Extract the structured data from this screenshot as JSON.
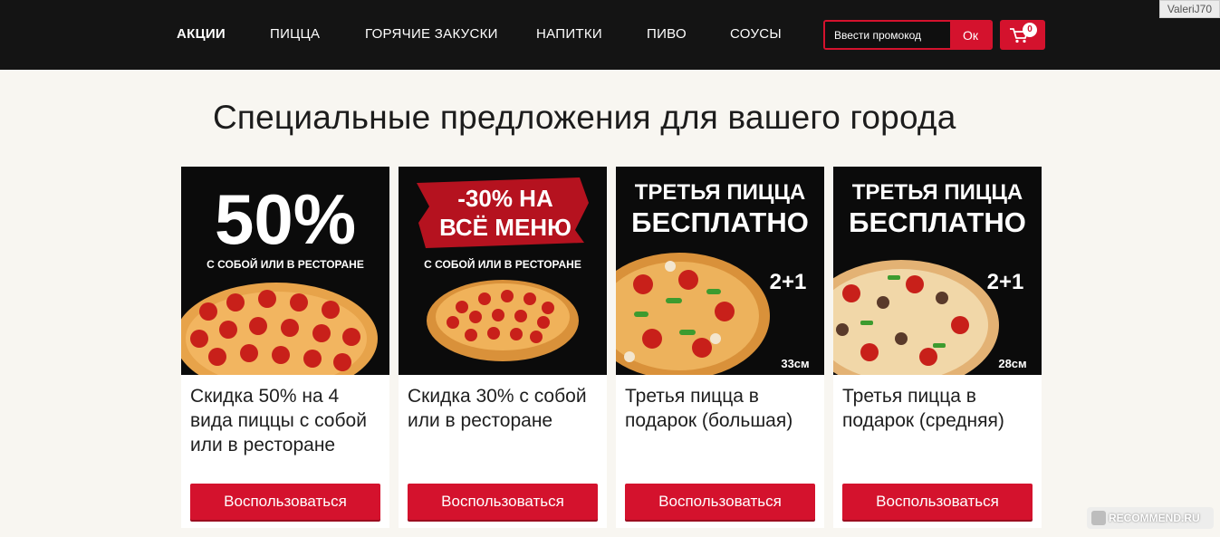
{
  "nav": {
    "items": [
      {
        "label": "АКЦИИ"
      },
      {
        "label": "ПИЦЦА"
      },
      {
        "label": "ГОРЯЧИЕ ЗАКУСКИ"
      },
      {
        "label": "НАПИТКИ"
      },
      {
        "label": "ПИВО"
      },
      {
        "label": "СОУСЫ"
      }
    ]
  },
  "promo": {
    "placeholder": "Ввести промокод",
    "button": "Ок"
  },
  "cart": {
    "count": "0"
  },
  "watermark": {
    "user": "ValeriJ70",
    "site": "RECOMMEND.RU"
  },
  "page": {
    "title": "Специальные предложения для вашего города"
  },
  "cards": [
    {
      "banner_big": "50%",
      "banner_small": "С СОБОЙ ИЛИ В РЕСТОРАНЕ",
      "title": "Скидка 50% на 4 вида пиццы с собой или в ресторане",
      "button": "Воспользоваться"
    },
    {
      "banner_line1": "-30% НА",
      "banner_line2": "ВСЁ МЕНЮ",
      "banner_small": "С СОБОЙ ИЛИ В РЕСТОРАНЕ",
      "title": "Скидка 30% с собой или в ресторане",
      "button": "Воспользоваться"
    },
    {
      "banner_line1": "ТРЕТЬЯ ПИЦЦА",
      "banner_line2": "БЕСПЛАТНО",
      "offer": "2+1",
      "size": "33см",
      "title": "Третья пицца в подарок (большая)",
      "button": "Воспользоваться"
    },
    {
      "banner_line1": "ТРЕТЬЯ ПИЦЦА",
      "banner_line2": "БЕСПЛАТНО",
      "offer": "2+1",
      "size": "28см",
      "title": "Третья пицца в подарок (средняя)",
      "button": "Воспользоваться"
    }
  ],
  "colors": {
    "accent": "#d4122d",
    "topbar": "#141414",
    "background": "#f8f6f1"
  }
}
